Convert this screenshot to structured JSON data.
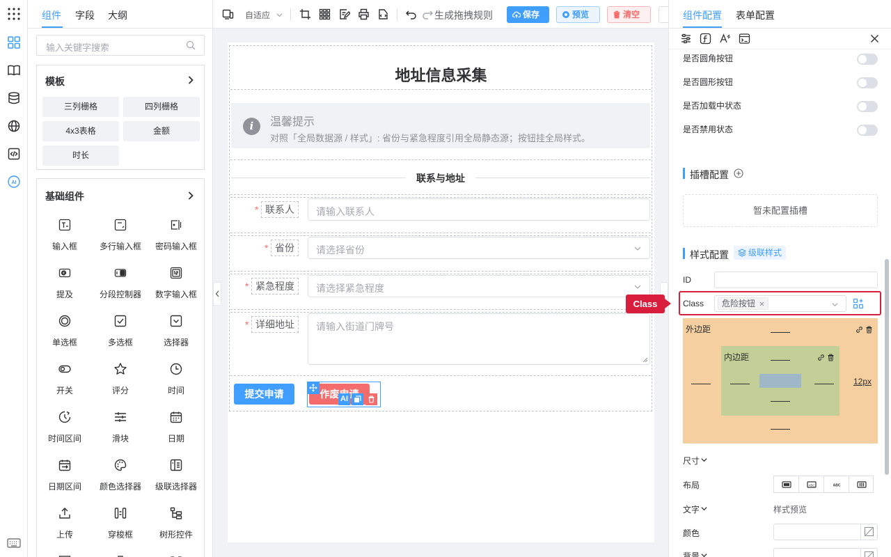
{
  "left_panel": {
    "tabs": [
      "组件",
      "字段",
      "大纲"
    ],
    "search_placeholder": "输入关键字搜索",
    "templates": {
      "title": "模板",
      "items": [
        "三列栅格",
        "四列栅格",
        "4x3表格",
        "金额",
        "时长"
      ]
    },
    "basic": {
      "title": "基础组件",
      "items": [
        "输入框",
        "多行输入框",
        "密码输入框",
        "提及",
        "分段控制器",
        "数字输入框",
        "单选框",
        "多选框",
        "选择器",
        "开关",
        "评分",
        "时间",
        "时间区间",
        "滑块",
        "日期",
        "日期区间",
        "颜色选择器",
        "级联选择器",
        "上传",
        "穿梭框",
        "树形控件"
      ]
    }
  },
  "toolbar": {
    "device_mode": "自适应",
    "rule_label": "生成拖拽规则",
    "save_label": "保存",
    "preview_label": "预览",
    "clear_label": "清空"
  },
  "form": {
    "title": "地址信息采集",
    "tip_title": "温馨提示",
    "tip_desc": "对照「全局数据源 / 样式」: 省份与紧急程度引用全局静态源；按钮挂全局样式。",
    "divider": "联系与地址",
    "fields": [
      {
        "label": "联系人",
        "placeholder": "请输入联系人"
      },
      {
        "label": "省份",
        "placeholder": "请选择省份"
      },
      {
        "label": "紧急程度",
        "placeholder": "请选择紧急程度"
      },
      {
        "label": "详细地址",
        "placeholder": "请输入街道门牌号"
      }
    ],
    "submit_label": "提交申请",
    "void_label": "作废申请",
    "ai_badge": "AI"
  },
  "right_panel": {
    "tabs": [
      "组件配置",
      "表单配置"
    ],
    "switch_rows": [
      "是否圆角按钮",
      "是否圆形按钮",
      "是否加载中状态",
      "是否禁用状态"
    ],
    "slot_title": "插槽配置",
    "slot_empty": "暂未配置插槽",
    "style_title": "样式配置",
    "cascade_tag": "级联样式",
    "id_label": "ID",
    "class_label": "Class",
    "class_tag": "危险按钮",
    "callout": "Class",
    "margin_label": "外边距",
    "padding_label": "内边距",
    "margin_right_value": "12px",
    "size_label": "尺寸",
    "layout_label": "布局",
    "text_label": "文字",
    "style_preview": "样式预览",
    "color_label": "颜色",
    "bg_label": "背景"
  },
  "colors": {
    "primary": "#409eff",
    "danger": "#f56c6c",
    "callout": "#d81e3c",
    "margin_box": "#f5cfa0",
    "padding_box": "#c3cf96"
  }
}
